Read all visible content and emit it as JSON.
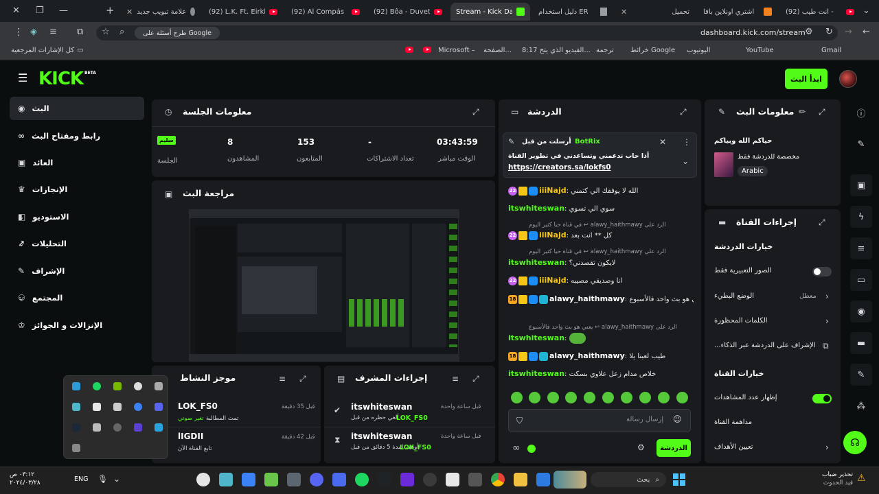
{
  "browser": {
    "tabs": [
      {
        "title": "(92) أنت طيب -",
        "icon": "youtube"
      },
      {
        "title": "اشتري اونلاين بأفا",
        "icon": "amazon"
      },
      {
        "title": "تحميل",
        "icon": "generic"
      },
      {
        "title": "دليل استخدام ER",
        "icon": "doc"
      },
      {
        "title": "Stream - Kick Da",
        "icon": "kick",
        "active": true
      },
      {
        "title": "(92) Bôa - Duvet",
        "icon": "youtube"
      },
      {
        "title": "(92) Al Compás",
        "icon": "youtube"
      },
      {
        "title": "(92) L.K. Ft. Eirkk",
        "icon": "youtube"
      },
      {
        "title": "علامة تبويب جديد",
        "icon": "chrome"
      }
    ],
    "url": "dashboard.kick.com/stream",
    "google_ask": "طرح أسئلة على Google",
    "bookmarks": [
      "Gmail",
      "YouTube",
      "اليوتيوب",
      "خرائط Google",
      "ترجمة",
      "8:17 الفيديو الذي يتح...",
      "الصفحة...",
      "Microsoft –",
      "كل الإشارات المرجعية"
    ]
  },
  "kick": {
    "logo": "KICK",
    "beta": "BETA",
    "go_live": "ابدأ البث",
    "sidebar": [
      {
        "label": "البث",
        "icon": "play-circle-icon",
        "active": true
      },
      {
        "label": "رابط ومفتاح البث",
        "icon": "link-icon"
      },
      {
        "label": "العائد",
        "icon": "dollar-icon"
      },
      {
        "label": "الإنجازات",
        "icon": "trophy-icon"
      },
      {
        "label": "الاستوديو",
        "icon": "studio-icon",
        "chevron": true
      },
      {
        "label": "التحليلات",
        "icon": "chart-icon",
        "chevron": true
      },
      {
        "label": "الإشراف",
        "icon": "wrench-icon"
      },
      {
        "label": "المجتمع",
        "icon": "people-icon",
        "chevron": true
      },
      {
        "label": "الإنزالات و الجوائز",
        "icon": "crown-icon"
      }
    ],
    "session": {
      "title": "معلومات الجلسة",
      "stats": [
        {
          "value": "03:43:59",
          "label": "الوقت مباشر"
        },
        {
          "value": "-",
          "label": "تعداد الاشتراكات"
        },
        {
          "value": "153",
          "label": "المتابعون"
        },
        {
          "value": "8",
          "label": "المشاهدون"
        },
        {
          "value": "سليم",
          "label": "الجلسة"
        }
      ]
    },
    "preview": {
      "title": "مراجعة البث"
    },
    "activity": {
      "title": "موجز النشاط",
      "items": [
        {
          "user": "LOK_FS0",
          "time": "قبل 35 دقيقة",
          "action": "تمت المطالبة",
          "highlight": "تغير صوتي"
        },
        {
          "user": "lIGDII",
          "time": "قبل 42 دقيقة",
          "action": "تابع القناة الآن"
        }
      ]
    },
    "mod_actions": {
      "title": "إجراءات المشرف",
      "items": [
        {
          "user": "itswhiteswan",
          "time": "قبل ساعة واحدة",
          "action": "ألغي حظره من قبل",
          "by": "LOK_FS0"
        },
        {
          "user": "itswhiteswan",
          "time": "قبل ساعة واحدة",
          "action": "أوقف لمدة 5 دقائق من قبل",
          "by": "LOK_FS0"
        }
      ]
    },
    "chat": {
      "title": "الدردشة",
      "pinned": {
        "sent_by": "أرسلت من قبل",
        "user": "BotRix",
        "text": "أذا حاب تدعمني وتساعدني في تطوير القناة",
        "link": "https://creators.sa/lokfs0"
      },
      "messages": [
        {
          "user": "iiiNajd",
          "text": "الله لا يوفقك الي كتمني",
          "color": "#f5c518",
          "badges": [
            "sub22",
            "crown",
            "mod"
          ]
        },
        {
          "user": "itswhiteswan",
          "text": "سوي الي تسوي",
          "color": "#53fc18",
          "badges": []
        },
        {
          "reply": "في قناة حيا كثير اليوم ↩ alawy_haithmawy الرد على"
        },
        {
          "user": "iiiNajd",
          "text": "كل ** انت بعد",
          "color": "#f5c518",
          "badges": [
            "sub22",
            "crown",
            "mod"
          ]
        },
        {
          "reply": "في قناة حيا كثير اليوم ↩ alawy_haithmawy الرد على"
        },
        {
          "user": "itswhiteswan",
          "text": "لايكون تقصدني؟",
          "color": "#53fc18",
          "badges": []
        },
        {
          "user": "iiiNajd",
          "text": "انا وصديقي مصيبه",
          "color": "#f5c518",
          "badges": [
            "sub22",
            "crown",
            "mod"
          ]
        },
        {
          "user": "alawy_haithmawy",
          "text": "يعني هو بث واحد فالأسبوع",
          "color": "#fff",
          "badges": [
            "sub18",
            "crown",
            "mod",
            "vip"
          ]
        },
        {
          "reply": "يعني هو بث واحد فالأسبوع ↩ alawy_haithmawy الرد على"
        },
        {
          "user": "itswhiteswan",
          "text": "",
          "color": "#53fc18",
          "badges": [],
          "emote": true
        },
        {
          "user": "alawy_haithmawy",
          "text": "طيب لعبنا يلا",
          "color": "#fff",
          "badges": [
            "sub18",
            "crown",
            "mod",
            "vip"
          ]
        },
        {
          "user": "itswhiteswan",
          "text": "خلاص مدام زعل علاوي بسكت",
          "color": "#53fc18",
          "badges": []
        }
      ],
      "input_placeholder": "إرسال رسالة",
      "send_label": "الدردشة"
    },
    "stream_info": {
      "title": "معلومات البث",
      "stream_title": "حياكم الله وبياكم",
      "category": "مخصصة للدردشة فقط",
      "language": "Arabic"
    },
    "channel_actions": {
      "title": "إجراءات القناة",
      "chat_options_title": "خيارات الدردشة",
      "chat_options": [
        {
          "label": "الصور التعبيرية فقط",
          "type": "toggle",
          "on": false
        },
        {
          "label": "الوضع البطيء",
          "value": "معطل",
          "type": "chevron"
        },
        {
          "label": "الكلمات المحظورة",
          "type": "chevron"
        },
        {
          "label": "...الإشراف على الدردشة عبر الذكاء",
          "type": "external"
        }
      ],
      "channel_options_title": "خيارات القناة",
      "channel_options": [
        {
          "label": "إظهار عدد المشاهدات",
          "type": "toggle",
          "on": true
        },
        {
          "label": "مداهمة القناة",
          "type": "none"
        },
        {
          "label": "تعيين الأهداف",
          "type": "chevron"
        }
      ]
    }
  },
  "taskbar": {
    "search": "بحث",
    "lang": "ENG",
    "time": "٠٣:١٢ ص",
    "date": "٢٠٢٤/٠٣/٢٨",
    "weather": "تحذير ضباب",
    "weather_sub": "قيد الحدوث"
  },
  "colors": {
    "kick_green": "#53fc18",
    "panel": "#191b1f",
    "bg": "#0b0e0f"
  }
}
